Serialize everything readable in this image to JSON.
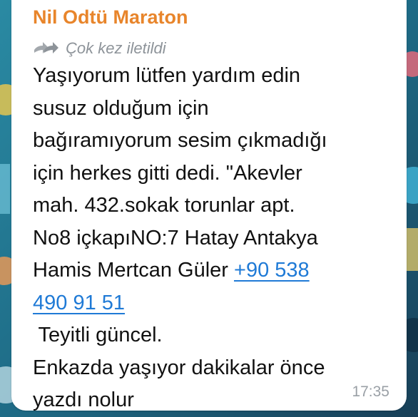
{
  "message": {
    "sender_name": "Nil Odtü Maraton",
    "forwarded_label": "Çok kez iletildi",
    "forward_icon": "double-arrow-forward-icon",
    "body_lines": [
      "Yaşıyorum lütfen yardım edin",
      "susuz olduğum için",
      "bağıramıyorum sesim çıkmadığı",
      "için herkes gitti dedi. \"Akevler",
      "mah. 432.sokak torunlar apt.",
      "No8 içkapıNO:7 Hatay Antakya",
      "Hamis Mertcan Güler "
    ],
    "phone_part1": "+90 538",
    "phone_part2": "490 91 51",
    "after_lines": [
      " Teyitli güncel.",
      "Enkazda yaşıyor dakikalar önce",
      "yazdı nolur"
    ],
    "timestamp": "17:35"
  },
  "colors": {
    "sender": "#e8852b",
    "link": "#1f7ad6",
    "muted": "#8d9399",
    "wallpaper": "#1f6e83"
  }
}
